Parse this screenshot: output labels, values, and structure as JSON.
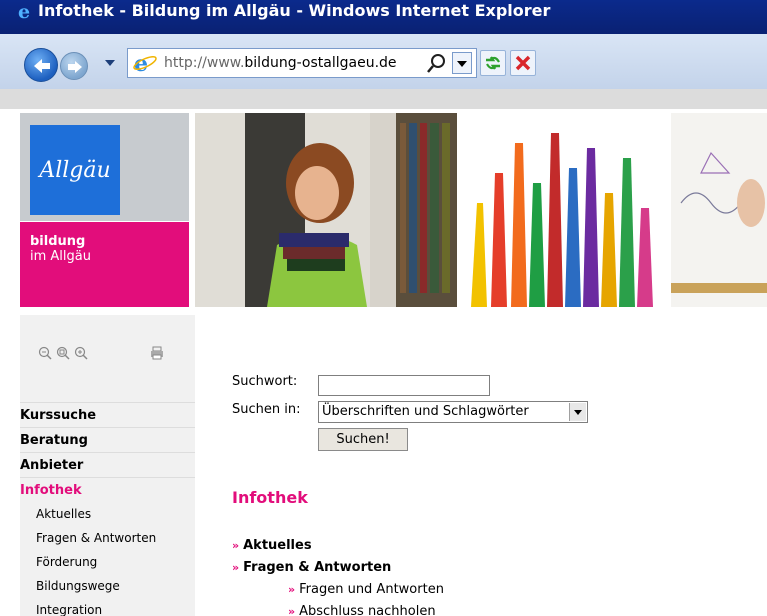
{
  "browser": {
    "window_title": "Infothek - Bildung im Allgäu - Windows Internet Explorer",
    "url_prefix": "http://www.",
    "url_host": "bildung-ostallgaeu.de"
  },
  "header": {
    "logo_text": "Allgäu",
    "brand_line1": "bildung",
    "brand_line2": "im Allgäu"
  },
  "sidebar": {
    "menu": [
      {
        "label": "Kurssuche",
        "active": false
      },
      {
        "label": "Beratung",
        "active": false
      },
      {
        "label": "Anbieter",
        "active": false
      },
      {
        "label": "Infothek",
        "active": true
      }
    ],
    "submenu": [
      "Aktuelles",
      "Fragen & Antworten",
      "Förderung",
      "Bildungswege",
      "Integration"
    ]
  },
  "search": {
    "suchwort_label": "Suchwort:",
    "suchwort_value": "",
    "suchen_in_label": "Suchen in:",
    "suchen_in_value": "Überschriften und Schlagwörter",
    "button_label": "Suchen!"
  },
  "main": {
    "heading": "Infothek",
    "links": [
      {
        "label": "Aktuelles",
        "bold": true,
        "level": 1
      },
      {
        "label": "Fragen & Antworten",
        "bold": true,
        "level": 1
      },
      {
        "label": "Fragen und Antworten",
        "bold": false,
        "level": 2
      },
      {
        "label": "Abschluss nachholen",
        "bold": false,
        "level": 2
      }
    ]
  },
  "colors": {
    "accent": "#e20d7b",
    "logo_blue": "#1e6fd9",
    "titlebar": "#0a2173"
  },
  "icons": [
    "ie-logo-icon",
    "back-arrow-icon",
    "forward-arrow-icon",
    "search-icon",
    "refresh-icon",
    "stop-icon",
    "zoom-out-icon",
    "zoom-reset-icon",
    "zoom-in-icon",
    "print-icon"
  ]
}
